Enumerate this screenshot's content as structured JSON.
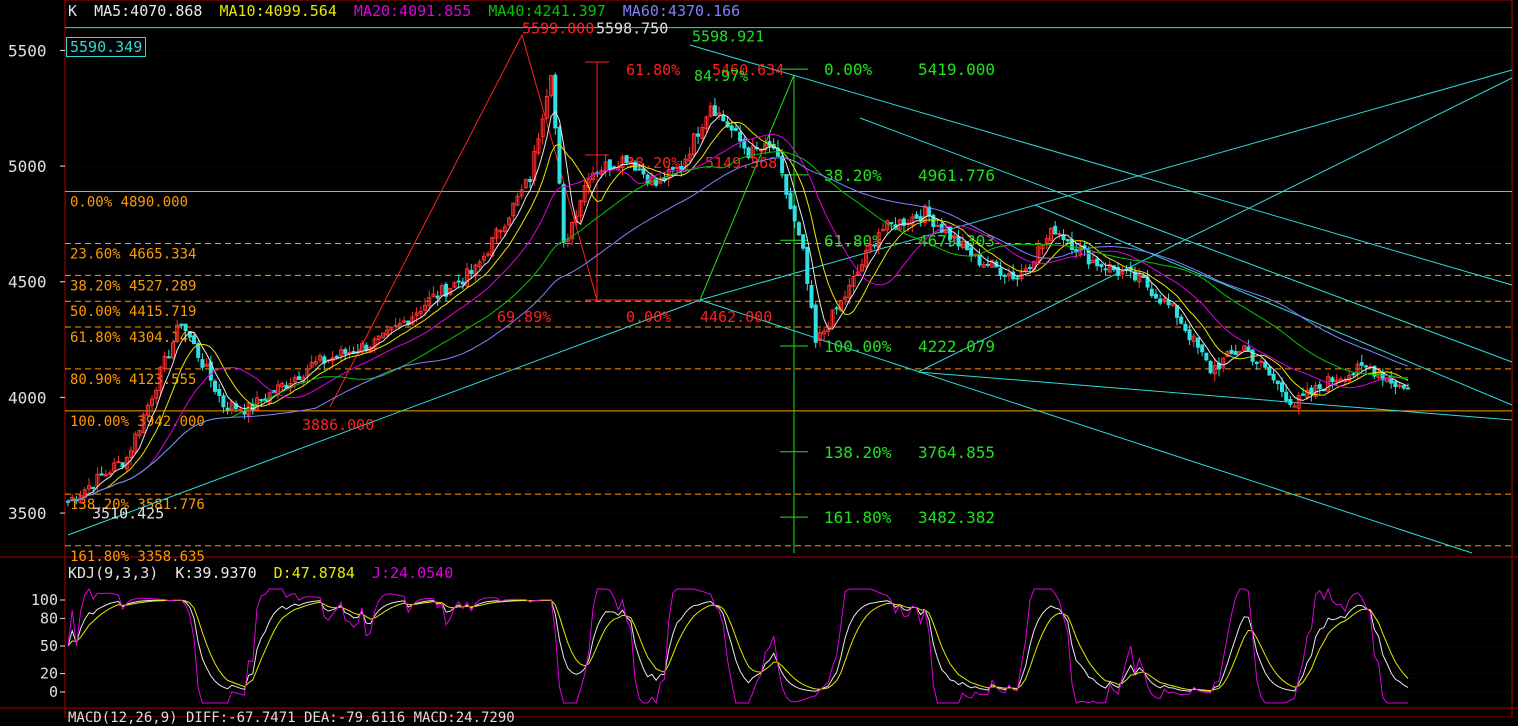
{
  "colors": {
    "bg": "#000000",
    "frame": "#b00000",
    "ma5": "#e8e8e8",
    "ma10": "#e8e800",
    "ma20": "#e000e0",
    "ma40": "#00c800",
    "ma60": "#8080ff",
    "up": "#ff3030",
    "down": "#30e0e0",
    "fibo": "#ff9a00",
    "fiboFan": "#20e020",
    "trend": "#30d8d8",
    "wave": "#ff2020",
    "yaxis": "#e0e0e0"
  },
  "header": {
    "symbol": "K",
    "ma5": "MA5:4070.868",
    "ma10": "MA10:4099.564",
    "ma20": "MA20:4091.855",
    "ma40": "MA40:4241.397",
    "ma60": "MA60:4370.166"
  },
  "kdj_header": {
    "name": "KDJ(9,3,3)",
    "k": "K:39.9370",
    "d": "D:47.8784",
    "j": "J:24.0540"
  },
  "macd_header": "MACD(12,26,9) DIFF:-67.7471 DEA:-79.6116 MACD:24.7290",
  "price_box": "5590.349",
  "chart_data": {
    "type": "candlestick",
    "ylim": [
      3310,
      5610
    ],
    "yticks": [
      "5500",
      "5000",
      "4500",
      "4000",
      "3500"
    ],
    "kdj_yticks": [
      "100",
      "80",
      "50",
      "20",
      "0"
    ],
    "fibo_levels": [
      {
        "label": "0.00% 4890.000",
        "v": 4890
      },
      {
        "label": "23.60% 4665.334",
        "v": 4665.334
      },
      {
        "label": "38.20% 4527.289",
        "v": 4527.289
      },
      {
        "label": "50.00% 4415.719",
        "v": 4415.719
      },
      {
        "label": "61.80% 4304.148",
        "v": 4304.148
      },
      {
        "label": "80.90% 4123.555",
        "v": 4123.555
      },
      {
        "label": "100.00% 3942.000",
        "v": 3942
      },
      {
        "label": "138.20% 3581.776",
        "v": 3581.776
      },
      {
        "label": "161.80% 3358.635",
        "v": 3358.635
      }
    ],
    "fan_levels": [
      {
        "label": "0.00%",
        "value": "5419.000",
        "v": 5419
      },
      {
        "label": "38.20%",
        "value": "4961.776",
        "v": 4961.776
      },
      {
        "label": "61.80%",
        "value": "4679.303",
        "v": 4679.303
      },
      {
        "label": "100.00%",
        "value": "4222.079",
        "v": 4222.079
      },
      {
        "label": "138.20%",
        "value": "3764.855",
        "v": 3764.855
      },
      {
        "label": "161.80%",
        "value": "3482.382",
        "v": 3482.382
      }
    ],
    "wave_labels": [
      {
        "text": "5599.000",
        "v": 5599
      },
      {
        "text": "61.80%",
        "v": 5420
      },
      {
        "text": "5460.634",
        "v": 5420
      },
      {
        "text": "84.97%",
        "v": 5393
      },
      {
        "text": "38.20%",
        "v": 5018
      },
      {
        "text": "5149.368",
        "v": 5018
      },
      {
        "text": "69.89%",
        "v": 4352
      },
      {
        "text": "0.00%",
        "v": 4352
      },
      {
        "text": "4462.000",
        "v": 4352
      },
      {
        "text": "3886.000",
        "v": 3886
      }
    ],
    "point_labels": [
      {
        "text": "5598.750",
        "v": 5598.75
      },
      {
        "text": "5598.921",
        "v": 5598.921
      },
      {
        "text": "3510.425",
        "v": 3510.425
      }
    ],
    "anchors": [
      {
        "i": 0,
        "v": 3550
      },
      {
        "i": 14,
        "v": 3740
      },
      {
        "i": 27,
        "v": 4330
      },
      {
        "i": 37,
        "v": 3970
      },
      {
        "i": 43,
        "v": 3950
      },
      {
        "i": 58,
        "v": 4140
      },
      {
        "i": 75,
        "v": 4250
      },
      {
        "i": 86,
        "v": 4420
      },
      {
        "i": 97,
        "v": 4550
      },
      {
        "i": 110,
        "v": 4950
      },
      {
        "i": 115,
        "v": 5420
      },
      {
        "i": 118,
        "v": 4650
      },
      {
        "i": 124,
        "v": 4970
      },
      {
        "i": 133,
        "v": 5040
      },
      {
        "i": 140,
        "v": 4920
      },
      {
        "i": 146,
        "v": 5000
      },
      {
        "i": 153,
        "v": 5270
      },
      {
        "i": 162,
        "v": 5060
      },
      {
        "i": 168,
        "v": 5080
      },
      {
        "i": 175,
        "v": 4620
      },
      {
        "i": 178,
        "v": 4230
      },
      {
        "i": 186,
        "v": 4470
      },
      {
        "i": 193,
        "v": 4720
      },
      {
        "i": 204,
        "v": 4800
      },
      {
        "i": 216,
        "v": 4600
      },
      {
        "i": 226,
        "v": 4520
      },
      {
        "i": 235,
        "v": 4730
      },
      {
        "i": 244,
        "v": 4590
      },
      {
        "i": 256,
        "v": 4500
      },
      {
        "i": 264,
        "v": 4360
      },
      {
        "i": 272,
        "v": 4120
      },
      {
        "i": 280,
        "v": 4220
      },
      {
        "i": 292,
        "v": 3970
      },
      {
        "i": 302,
        "v": 4090
      },
      {
        "i": 310,
        "v": 4130
      },
      {
        "i": 318,
        "v": 4040
      }
    ],
    "ma_final": [
      4070.868,
      4099.564,
      4091.855,
      4241.397,
      4370.166
    ],
    "kdj_final": [
      39.937,
      47.8784,
      24.054
    ],
    "count": 320
  }
}
